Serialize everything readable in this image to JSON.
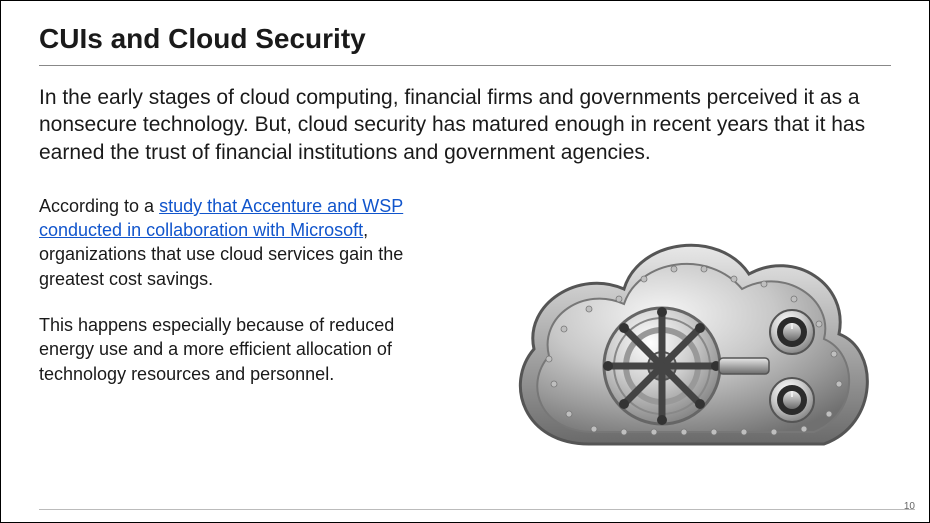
{
  "title": "CUIs and Cloud Security",
  "intro": "In the early stages of cloud computing, financial firms and governments perceived it as a nonsecure technology. But, cloud security has matured enough in recent years that it has earned the trust of financial institutions and government agencies.",
  "para1_prefix": "According to a ",
  "para1_link": "study that Accenture and WSP conducted in collaboration with Microsoft",
  "para1_suffix": ", organizations that use cloud services gain the greatest cost savings.",
  "para2": "This happens especially because of reduced energy use and a more efficient allocation of technology resources and personnel.",
  "page_number": "10",
  "image_alt": "cloud-vault-illustration"
}
